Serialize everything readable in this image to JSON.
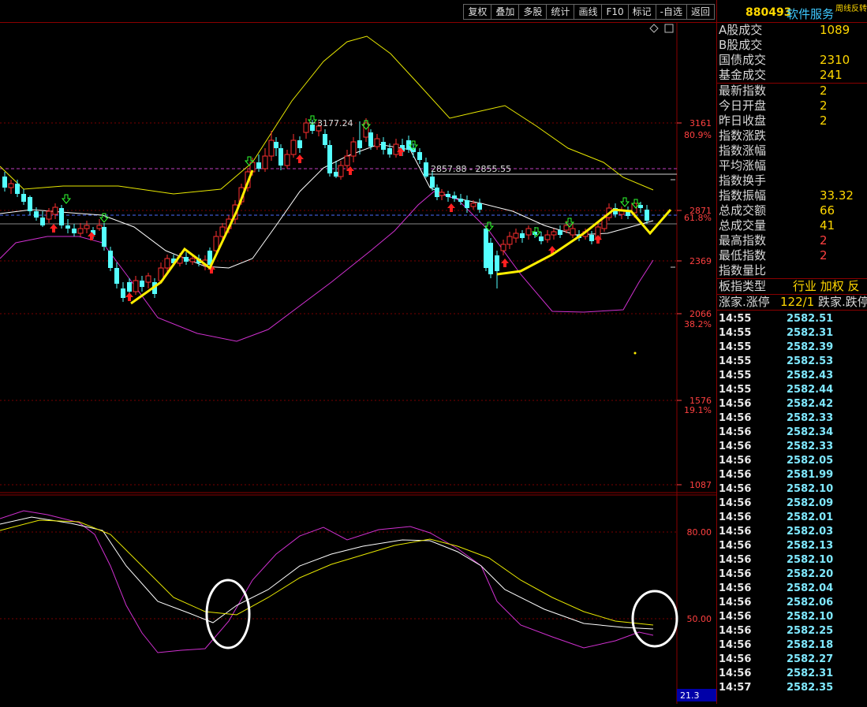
{
  "toolbar": {
    "tabs": [
      {
        "id": "fuquan",
        "label": "复权"
      },
      {
        "id": "diejia",
        "label": "叠加"
      },
      {
        "id": "duogu",
        "label": "多股"
      },
      {
        "id": "tongji",
        "label": "统计"
      },
      {
        "id": "huaxian",
        "label": "画线"
      },
      {
        "id": "f10",
        "label": "F10"
      },
      {
        "id": "biaoji",
        "label": "标记"
      },
      {
        "id": "zixuan",
        "label": "-自选"
      },
      {
        "id": "fanhui",
        "label": "返回"
      }
    ]
  },
  "chart": {
    "price_axis": [
      "3161",
      "2871",
      "2369",
      "2066",
      "1576",
      "1087"
    ],
    "pct_axis": [
      "80.9%",
      "61.8%",
      "38.2%",
      "19.1%"
    ],
    "high_annotation": "3177.24",
    "range_annotation": "2857.88 - 2855.55",
    "osc_axis": [
      "80.00",
      "50.00"
    ],
    "osc_bottom_value": "21.3",
    "colors": {
      "up": "#ff3030",
      "down": "#54ffff",
      "ma": "#ffffff",
      "upper": "#e8e800",
      "lower": "#d030d0",
      "trend": "#ffee00"
    }
  },
  "info": {
    "code": "880493",
    "name": "软件服务",
    "mini": "周线反转",
    "rows": [
      {
        "k": "A股成交",
        "v": "1089"
      },
      {
        "k": "B股成交",
        "v": ""
      },
      {
        "k": "国债成交",
        "v": "2310"
      },
      {
        "k": "基金成交",
        "v": "241"
      }
    ],
    "rows2": [
      {
        "k": "最新指数",
        "v": "2"
      },
      {
        "k": "今日开盘",
        "v": "2"
      },
      {
        "k": "昨日收盘",
        "v": "2"
      },
      {
        "k": "指数涨跌",
        "v": ""
      },
      {
        "k": "指数涨幅",
        "v": ""
      },
      {
        "k": "平均涨幅",
        "v": ""
      },
      {
        "k": "指数换手",
        "v": ""
      },
      {
        "k": "指数振幅",
        "v": "33.32"
      },
      {
        "k": "总成交额",
        "v": "66"
      },
      {
        "k": "总成交量",
        "v": "41"
      },
      {
        "k": "最高指数",
        "v": "2"
      },
      {
        "k": "最低指数",
        "v": "2"
      },
      {
        "k": "指数量比",
        "v": ""
      }
    ],
    "type_label": "板指类型",
    "type_value": "行业 加权 反",
    "zhang_label": "涨家.涨停",
    "zhang_value": "122/1",
    "die_label": "跌家.跌停"
  },
  "ticks": [
    {
      "t": "14:55",
      "p": "2582.51"
    },
    {
      "t": "14:55",
      "p": "2582.31"
    },
    {
      "t": "14:55",
      "p": "2582.39"
    },
    {
      "t": "14:55",
      "p": "2582.53"
    },
    {
      "t": "14:55",
      "p": "2582.43"
    },
    {
      "t": "14:55",
      "p": "2582.44"
    },
    {
      "t": "14:56",
      "p": "2582.42"
    },
    {
      "t": "14:56",
      "p": "2582.33"
    },
    {
      "t": "14:56",
      "p": "2582.34"
    },
    {
      "t": "14:56",
      "p": "2582.33"
    },
    {
      "t": "14:56",
      "p": "2582.05"
    },
    {
      "t": "14:56",
      "p": "2581.99"
    },
    {
      "t": "14:56",
      "p": "2582.10"
    },
    {
      "t": "14:56",
      "p": "2582.09"
    },
    {
      "t": "14:56",
      "p": "2582.01"
    },
    {
      "t": "14:56",
      "p": "2582.03"
    },
    {
      "t": "14:56",
      "p": "2582.13"
    },
    {
      "t": "14:56",
      "p": "2582.10"
    },
    {
      "t": "14:56",
      "p": "2582.20"
    },
    {
      "t": "14:56",
      "p": "2582.04"
    },
    {
      "t": "14:56",
      "p": "2582.06"
    },
    {
      "t": "14:56",
      "p": "2582.10"
    },
    {
      "t": "14:56",
      "p": "2582.25"
    },
    {
      "t": "14:56",
      "p": "2582.18"
    },
    {
      "t": "14:56",
      "p": "2582.27"
    },
    {
      "t": "14:56",
      "p": "2582.31"
    },
    {
      "t": "14:57",
      "p": "2582.35"
    }
  ]
}
